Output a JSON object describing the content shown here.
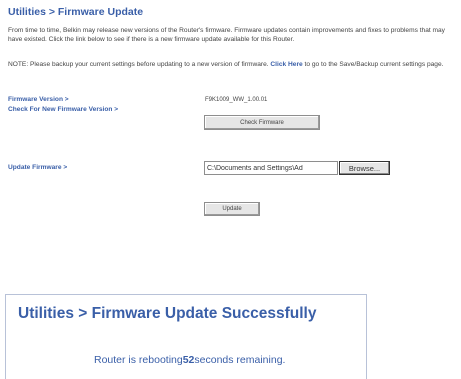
{
  "top": {
    "title": "Utilities > Firmware Update",
    "intro": "From time to time, Belkin may release new versions of the Router's firmware. Firmware updates contain improvements and fixes to problems that may have existed. Click the link below to see if there is a new firmware update available for this Router.",
    "note_prefix": "NOTE: Please backup your current settings before updating to a new version of firmware. ",
    "note_link": "Click Here",
    "note_suffix": " to go to the Save/Backup current settings page.",
    "firmware_version_label": "Firmware Version >",
    "firmware_version_value": "F9K1009_WW_1.00.01",
    "check_label": "Check For New Firmware Version >",
    "check_button": "Check Firmware",
    "update_label": "Update Firmware >",
    "file_path": "C:\\Documents and Settings\\Ad",
    "browse_button": "Browse...",
    "update_button": "Update"
  },
  "bottom": {
    "title": "Utilities > Firmware Update Successfully",
    "reboot_prefix": "Router is rebooting",
    "reboot_seconds": "52",
    "reboot_suffix": "seconds remaining."
  },
  "colors": {
    "title_blue": "#3a5fa8",
    "text_gray": "#444444",
    "button_face": "#e6e6e6"
  }
}
